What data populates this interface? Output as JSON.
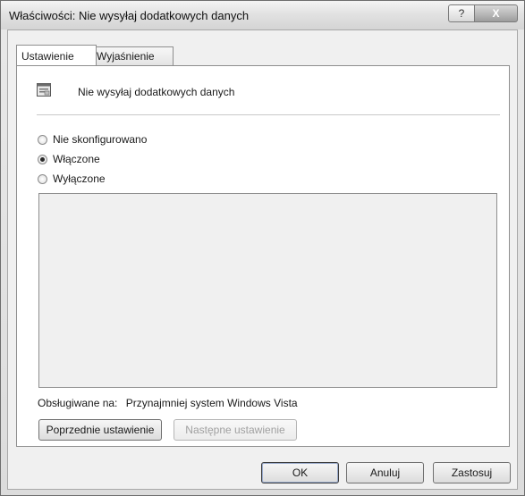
{
  "window": {
    "title": "Właściwości: Nie wysyłaj dodatkowych danych",
    "help_label": "?",
    "close_label": "X"
  },
  "tabs": [
    {
      "label": "Ustawienie",
      "active": true
    },
    {
      "label": "Wyjaśnienie",
      "active": false
    }
  ],
  "setting": {
    "name": "Nie wysyłaj dodatkowych danych",
    "icon": "policy-setting-icon"
  },
  "radio_options": [
    {
      "label": "Nie skonfigurowano",
      "checked": false
    },
    {
      "label": "Włączone",
      "checked": true
    },
    {
      "label": "Wyłączone",
      "checked": false
    }
  ],
  "supported": {
    "label": "Obsługiwane na:",
    "value": "Przynajmniej system Windows Vista"
  },
  "nav_buttons": {
    "previous": "Poprzednie ustawienie",
    "next": "Następne ustawienie"
  },
  "dialog_buttons": {
    "ok": "OK",
    "cancel": "Anuluj",
    "apply": "Zastosuj"
  }
}
